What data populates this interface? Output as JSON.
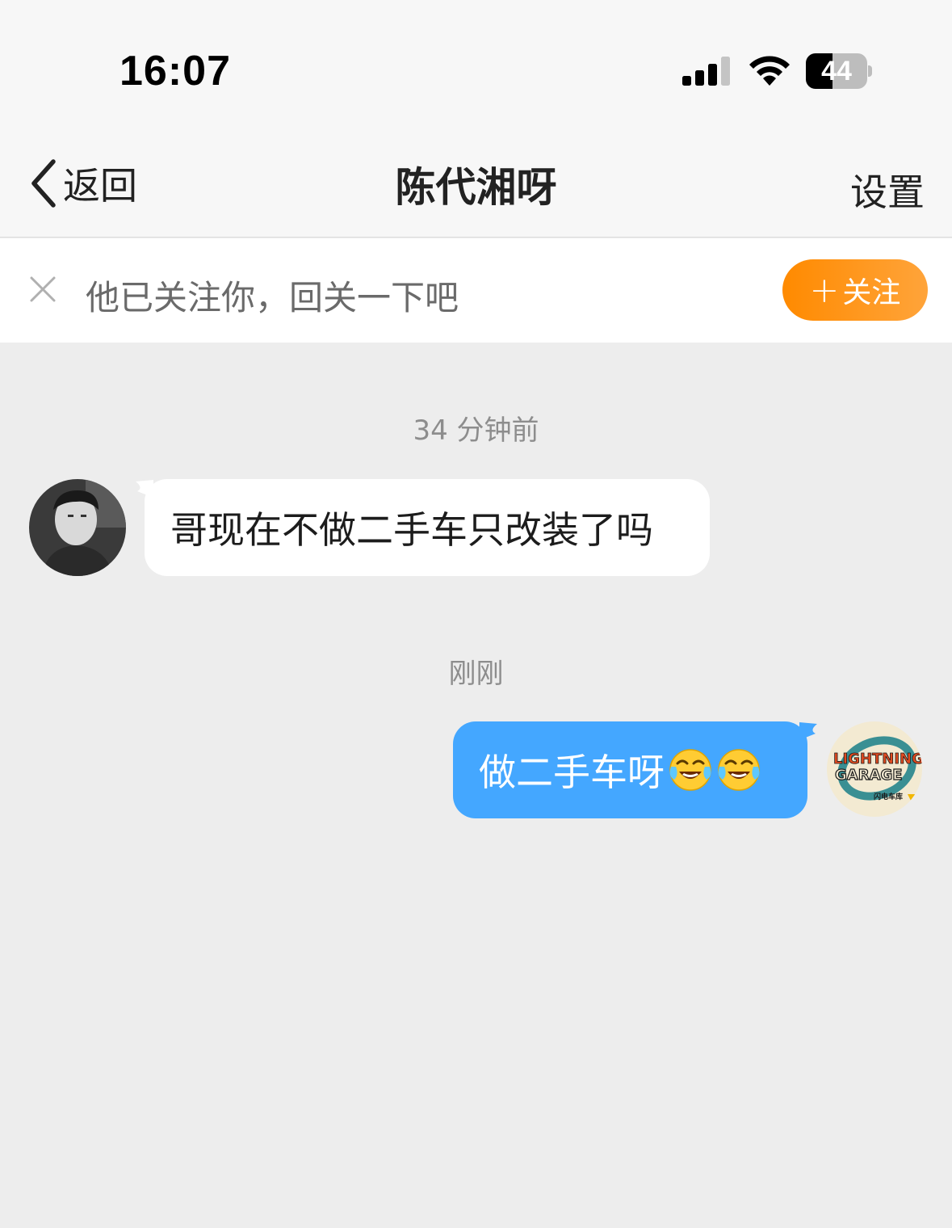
{
  "status_bar": {
    "time": "16:07",
    "battery_level": "44",
    "icons": [
      "signal-icon",
      "wifi-icon",
      "battery-icon"
    ]
  },
  "nav": {
    "back_label": "返回",
    "title": "陈代湘呀",
    "settings_label": "设置",
    "icons": [
      "chevron-left-icon"
    ]
  },
  "follow_banner": {
    "text": "他已关注你，回关一下吧",
    "button_label": "关注",
    "button_plus": "+",
    "icons": [
      "close-icon",
      "plus-icon"
    ],
    "button_color": "#ff8a00"
  },
  "messages": [
    {
      "timestamp": "34 分钟前",
      "direction": "incoming",
      "text": "哥现在不做二手车只改装了吗"
    },
    {
      "timestamp": "刚刚",
      "direction": "outgoing",
      "text": "做二手车呀",
      "emojis": [
        "laughing-crying-emoji",
        "laughing-crying-emoji"
      ]
    }
  ],
  "my_avatar": {
    "logo_text_line1": "LIGHTNING",
    "logo_text_line2": "GARAGE",
    "logo_subtitle": "闪电车库"
  },
  "colors": {
    "outgoing_bubble": "#44a7ff",
    "incoming_bubble": "#ffffff",
    "chat_background": "#ededed"
  }
}
